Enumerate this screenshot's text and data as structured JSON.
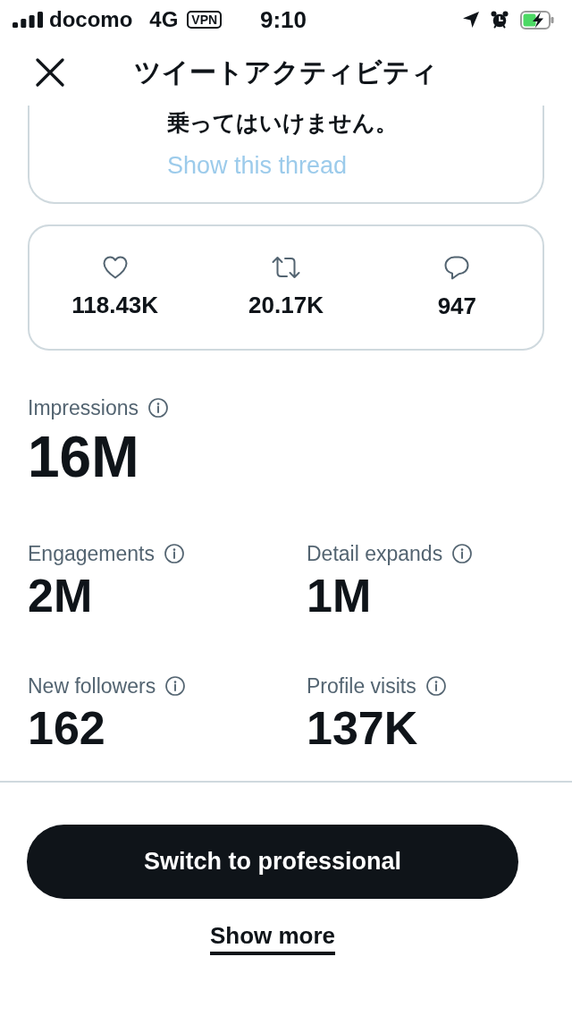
{
  "status_bar": {
    "carrier": "docomo",
    "network": "4G",
    "vpn": "VPN",
    "time": "9:10"
  },
  "header": {
    "title": "ツイートアクティビティ"
  },
  "tweet": {
    "text": "乗ってはいけません。",
    "thread_link": "Show this thread"
  },
  "engagement": [
    {
      "kind": "like",
      "count": "118.43K"
    },
    {
      "kind": "retweet",
      "count": "20.17K"
    },
    {
      "kind": "reply",
      "count": "947"
    }
  ],
  "metrics": [
    {
      "kind": "headline",
      "label": "Impressions",
      "value": "16M"
    },
    {
      "kind": "standard",
      "label": "Engagements",
      "value": "2M"
    },
    {
      "kind": "standard",
      "label": "Detail expands",
      "value": "1M"
    },
    {
      "kind": "standard",
      "label": "New followers",
      "value": "162"
    },
    {
      "kind": "standard",
      "label": "Profile visits",
      "value": "137K"
    }
  ],
  "actions": {
    "primary_button": "Switch to professional",
    "show_more_link": "Show more"
  }
}
